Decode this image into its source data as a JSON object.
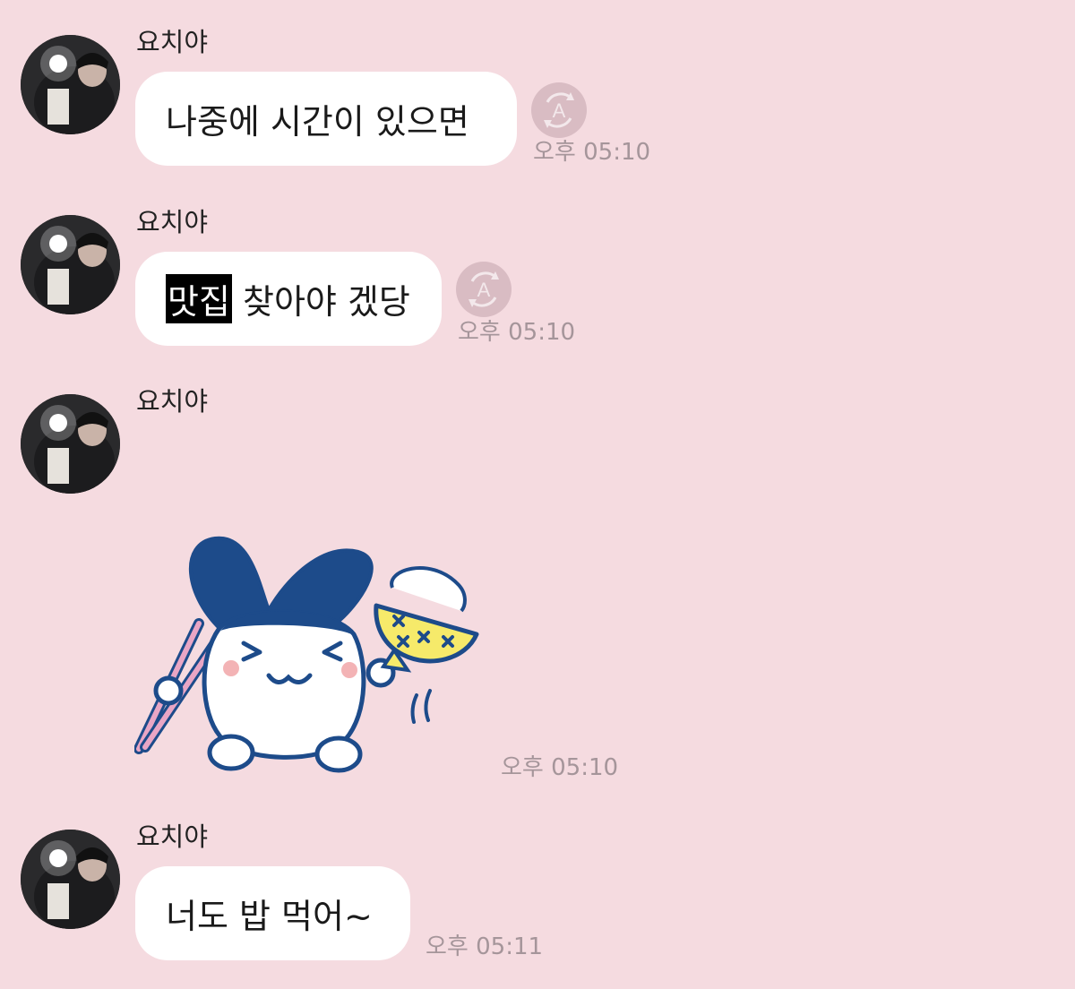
{
  "sender_name": "요치야",
  "messages": [
    {
      "type": "text",
      "text": "나중에 시간이 있으면",
      "time": "오후 05:10"
    },
    {
      "type": "text",
      "highlight": "맛집",
      "rest": " 찾아야 겠당",
      "time": "오후 05:10"
    },
    {
      "type": "sticker",
      "sticker": "rabbit-eating-rice-sticker",
      "time": "오후 05:10"
    },
    {
      "type": "text",
      "text": "너도 밥 먹어~",
      "time": "오후 05:11"
    }
  ],
  "translate_icon_letter": "A",
  "colors": {
    "background": "#f5dbe0",
    "bubble": "#ffffff",
    "timestamp": "#a5959a",
    "translate_button": "#d9bcc3",
    "sticker_blue": "#1d4b8a",
    "sticker_yellow": "#f6ea6a",
    "sticker_pink": "#e9a6c5"
  }
}
